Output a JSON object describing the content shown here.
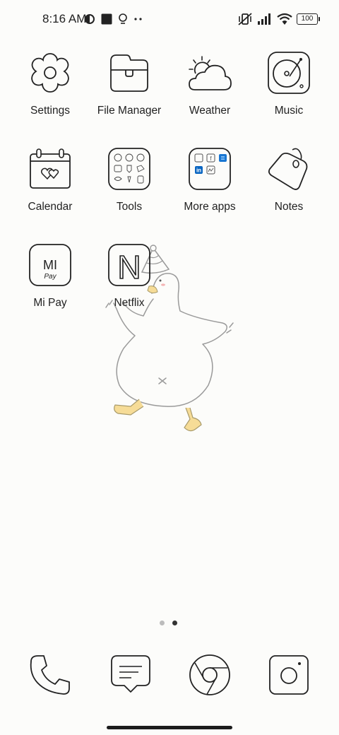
{
  "status_bar": {
    "time": "8:16 AM",
    "battery": "100",
    "left_icons": [
      "data-saver-icon",
      "app-square-icon",
      "bulb-icon",
      "more-dots-icon"
    ],
    "right_icons": [
      "vibrate-off-icon",
      "signal-icon",
      "wifi-icon",
      "battery-icon"
    ]
  },
  "apps": [
    {
      "label": "Settings",
      "icon": "gear-flower-icon"
    },
    {
      "label": "File Manager",
      "icon": "folder-icon"
    },
    {
      "label": "Weather",
      "icon": "weather-sun-cloud-icon"
    },
    {
      "label": "Music",
      "icon": "record-player-icon"
    },
    {
      "label": "Calendar",
      "icon": "calendar-hearts-icon"
    },
    {
      "label": "Tools",
      "icon": "tools-folder-icon"
    },
    {
      "label": "More apps",
      "icon": "more-apps-folder-icon"
    },
    {
      "label": "Notes",
      "icon": "tag-icon"
    },
    {
      "label": "Mi Pay",
      "icon": "mi-pay-icon"
    },
    {
      "label": "Netflix",
      "icon": "netflix-icon"
    }
  ],
  "mi_pay_text": {
    "mi": "MI",
    "pay": "Pay"
  },
  "netflix_letter": "N",
  "dock": [
    {
      "name": "phone",
      "icon": "phone-icon"
    },
    {
      "name": "messages",
      "icon": "message-icon"
    },
    {
      "name": "chrome",
      "icon": "browser-icon"
    },
    {
      "name": "camera",
      "icon": "camera-icon"
    }
  ],
  "page_indicator": {
    "pages": 2,
    "current": 2
  },
  "colors": {
    "background": "#fcfcfa",
    "stroke": "#222222",
    "duck_feet": "#f6dc97",
    "linkedin_blue": "#0a66c2"
  }
}
